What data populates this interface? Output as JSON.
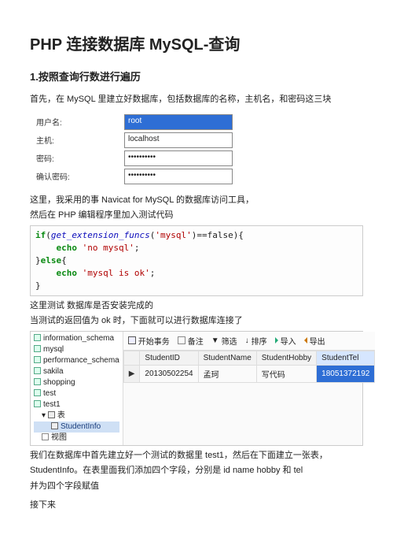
{
  "title": "PHP 连接数据库 MySQL-查询",
  "h2_1": "1.按照查询行数进行遍历",
  "intro": "首先，在 MySQL 里建立好数据库，包括数据库的名称，主机名，和密码这三块",
  "form": {
    "labels": {
      "user": "用户名:",
      "host": "主机:",
      "pwd": "密码:",
      "pwd2": "确认密码:"
    },
    "values": {
      "user": "root",
      "host": "localhost",
      "pwd": "••••••••••",
      "pwd2": "••••••••••"
    }
  },
  "para_tool": "这里，我采用的事 Navicat for MySQL 的数据库访问工具，",
  "para_then": "然后在 PHP 编辑程序里加入测试代码",
  "code": {
    "if": "if",
    "func": "get_extension_funcs",
    "arg": "'mysql'",
    "op": "==false",
    "echo": "echo",
    "s1": "'no mysql'",
    "else": "else",
    "s2": "'mysql is ok'"
  },
  "para_test1": "这里测试 数据库是否安装完成的",
  "para_test2": "当测试的返回值为 ok 时，下面就可以进行数据库连接了",
  "dbtree": {
    "n0": "information_schema",
    "n1": "mysql",
    "n2": "performance_schema",
    "n3": "sakila",
    "n4": "shopping",
    "n5": "test",
    "n6": "test1",
    "n6a_label": "表",
    "n6a1": "StudentInfo",
    "n6b_label": "视图"
  },
  "toolbar": {
    "start": "开始事务",
    "memo": "备注",
    "filter": "筛选",
    "sort": "排序",
    "import": "导入",
    "export": "导出"
  },
  "grid": {
    "cols": [
      "StudentID",
      "StudentName",
      "StudentHobby",
      "StudentTel"
    ],
    "row": {
      "id": "20130502254",
      "name": "孟珂",
      "hobby": "写代码",
      "tel": "18051372192"
    }
  },
  "para_after1": "我们在数据库中首先建立好一个测试的数据里 test1，然后在下面建立一张表，",
  "para_after2": "StudentInfo。在表里面我们添加四个字段，分别是 id name hobby  和 tel",
  "para_after3": "并为四个字段赋值",
  "para_next": "接下来"
}
